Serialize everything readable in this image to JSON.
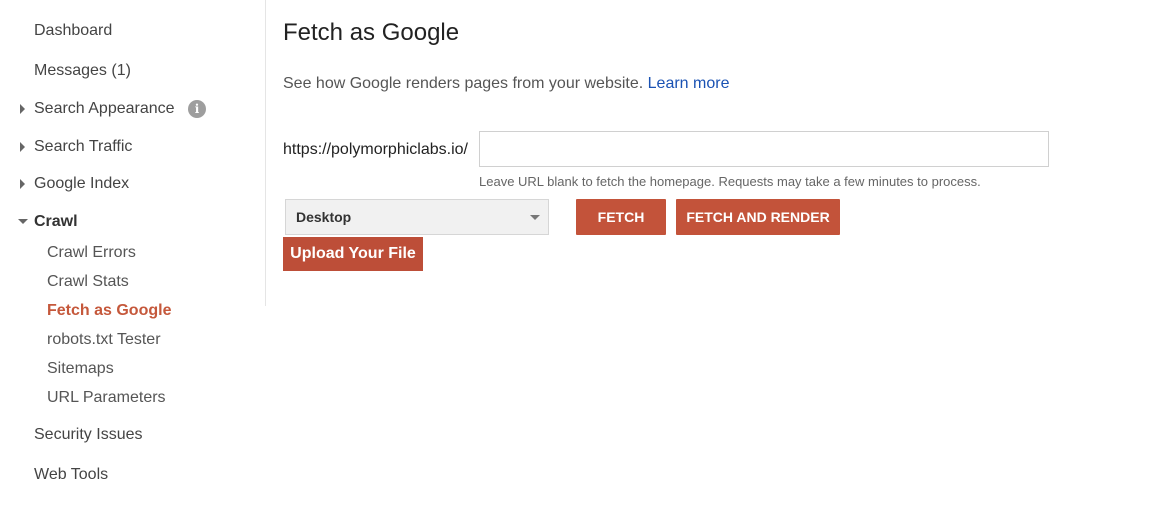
{
  "sidebar": {
    "items": [
      {
        "label": "Dashboard"
      },
      {
        "label": "Messages (1)"
      },
      {
        "label": "Search Appearance"
      },
      {
        "label": "Search Traffic"
      },
      {
        "label": "Google Index"
      },
      {
        "label": "Crawl"
      },
      {
        "label": "Security Issues"
      },
      {
        "label": "Web Tools"
      }
    ],
    "info_icon_glyph": "i",
    "crawl_sub": [
      {
        "label": "Crawl Errors"
      },
      {
        "label": "Crawl Stats"
      },
      {
        "label": "Fetch as Google"
      },
      {
        "label": "robots.txt Tester"
      },
      {
        "label": "Sitemaps"
      },
      {
        "label": "URL Parameters"
      }
    ]
  },
  "main": {
    "title": "Fetch as Google",
    "description": "See how Google renders pages from your website. ",
    "learn_more": "Learn more",
    "url_prefix": "https://polymorphiclabs.io/",
    "url_value": "",
    "url_placeholder": "",
    "hint": "Leave URL blank to fetch the homepage. Requests may take a few minutes to process.",
    "device_selected": "Desktop",
    "fetch_label": "FETCH",
    "fetch_render_label": "FETCH AND RENDER",
    "upload_label": "Upload Your File"
  },
  "colors": {
    "accent": "#c3533a",
    "active_link": "#c5583b",
    "link": "#1a52b3"
  }
}
